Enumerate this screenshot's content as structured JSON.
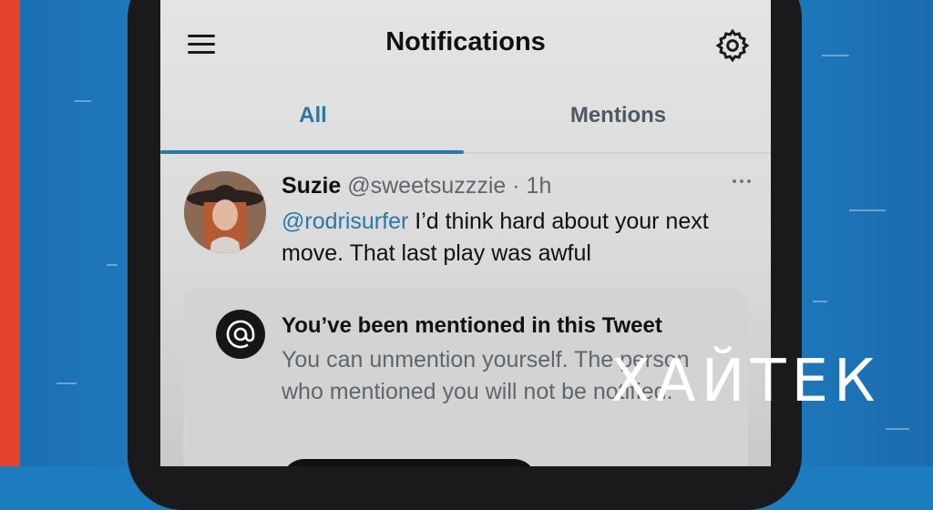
{
  "header": {
    "title": "Notifications"
  },
  "tabs": [
    {
      "label": "All",
      "active": true
    },
    {
      "label": "Mentions",
      "active": false
    }
  ],
  "tweet": {
    "name": "Suzie",
    "handle": "@sweetsuzzzie",
    "separator": "·",
    "time": "1h",
    "mention": "@rodrisurfer",
    "text": " I’d think hard about your next move. That last play was awful"
  },
  "mention_card": {
    "title": "You’ve been mentioned in this Tweet",
    "body": "You can unmention yourself. The person who mentioned you will not be notified."
  },
  "watermark": "ХАЙТЕК",
  "colors": {
    "accent": "#2a78a8",
    "left_stripe": "#e4422a",
    "background": "#1d7cc0"
  },
  "icons": [
    "menu-icon",
    "gear-icon",
    "more-icon",
    "at-icon",
    "avatar"
  ]
}
